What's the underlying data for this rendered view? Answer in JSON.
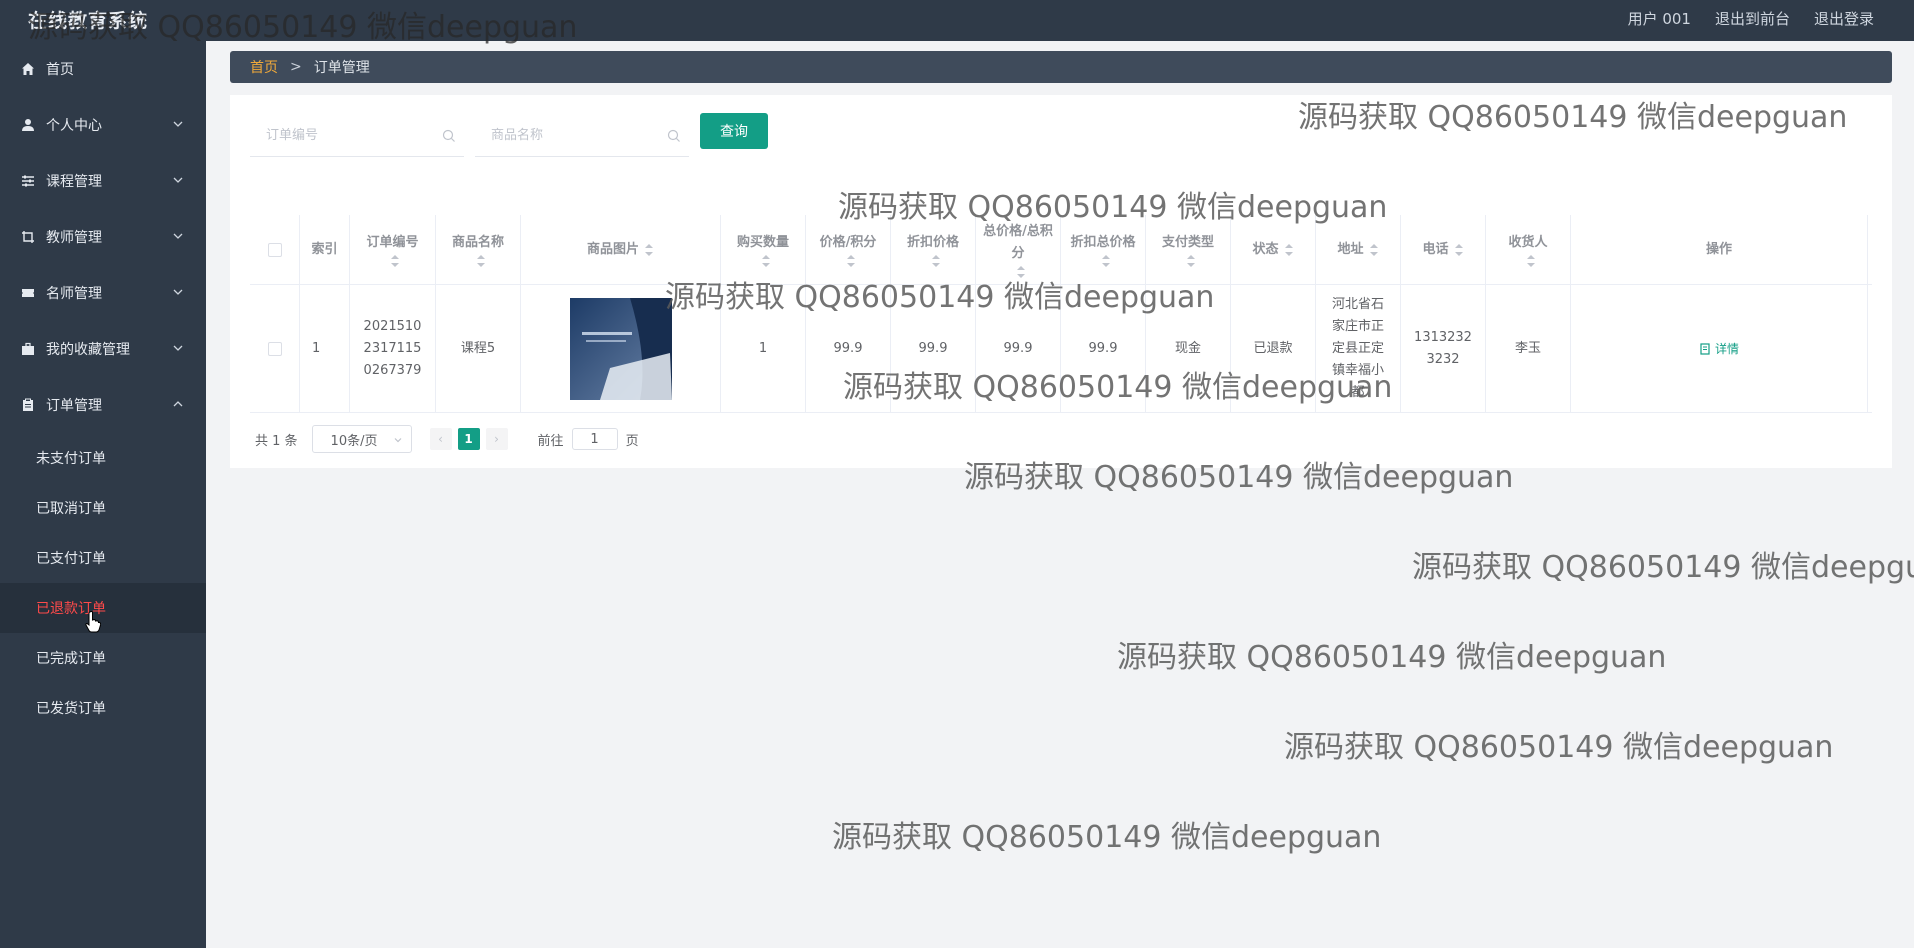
{
  "app": {
    "title": "在线教育系统"
  },
  "header": {
    "user": "用户 001",
    "to_front": "退出到前台",
    "logout": "退出登录"
  },
  "sidebar": {
    "items": [
      {
        "label": "首页",
        "icon": "home-icon",
        "expandable": false
      },
      {
        "label": "个人中心",
        "icon": "user-icon",
        "expandable": true
      },
      {
        "label": "课程管理",
        "icon": "sliders-icon",
        "expandable": true
      },
      {
        "label": "教师管理",
        "icon": "crop-icon",
        "expandable": true
      },
      {
        "label": "名师管理",
        "icon": "ticket-icon",
        "expandable": true
      },
      {
        "label": "我的收藏管理",
        "icon": "briefcase-icon",
        "expandable": true
      },
      {
        "label": "订单管理",
        "icon": "clipboard-icon",
        "expandable": true,
        "expanded": true
      }
    ],
    "sub_items": [
      "未支付订单",
      "已取消订单",
      "已支付订单",
      "已退款订单",
      "已完成订单",
      "已发货订单"
    ],
    "active_sub": "已退款订单"
  },
  "breadcrumb": {
    "home": "首页",
    "separator": ">",
    "current": "订单管理"
  },
  "search": {
    "order_no_placeholder": "订单编号",
    "product_placeholder": "商品名称",
    "button": "查询"
  },
  "table": {
    "headers": {
      "index": "索引",
      "order_no": "订单编号",
      "product": "商品名称",
      "image": "商品图片",
      "qty": "购买数量",
      "price": "价格/积分",
      "discount": "折扣价格",
      "total": "总价格/总积分",
      "discount_total": "折扣总价格",
      "pay_type": "支付类型",
      "status": "状态",
      "address": "地址",
      "phone": "电话",
      "receiver": "收货人",
      "action": "操作"
    },
    "rows": [
      {
        "index": "1",
        "order_no": "2021510231711502673 79",
        "order_no_display": "20215102317115 0267379",
        "product": "课程5",
        "qty": "1",
        "price": "99.9",
        "discount": "99.9",
        "total": "99.9",
        "discount_total": "99.9",
        "pay_type": "现金",
        "status": "已退款",
        "address": "河北省石家庄市正定县正定镇幸福小都",
        "phone": "13132323232",
        "receiver": "李玉",
        "action": "详情"
      }
    ]
  },
  "pagination": {
    "total": "共 1 条",
    "page_size": "10条/页",
    "current_page": "1",
    "goto_label": "前往",
    "goto_value": "1",
    "page_suffix": "页"
  },
  "watermark": "源码获取 QQ86050149 微信deepguan",
  "colors": {
    "accent": "#139e86",
    "sidebar_bg": "#2f3a48",
    "active_text": "#ff4a4a",
    "breadcrumb_home": "#f0a93a"
  }
}
